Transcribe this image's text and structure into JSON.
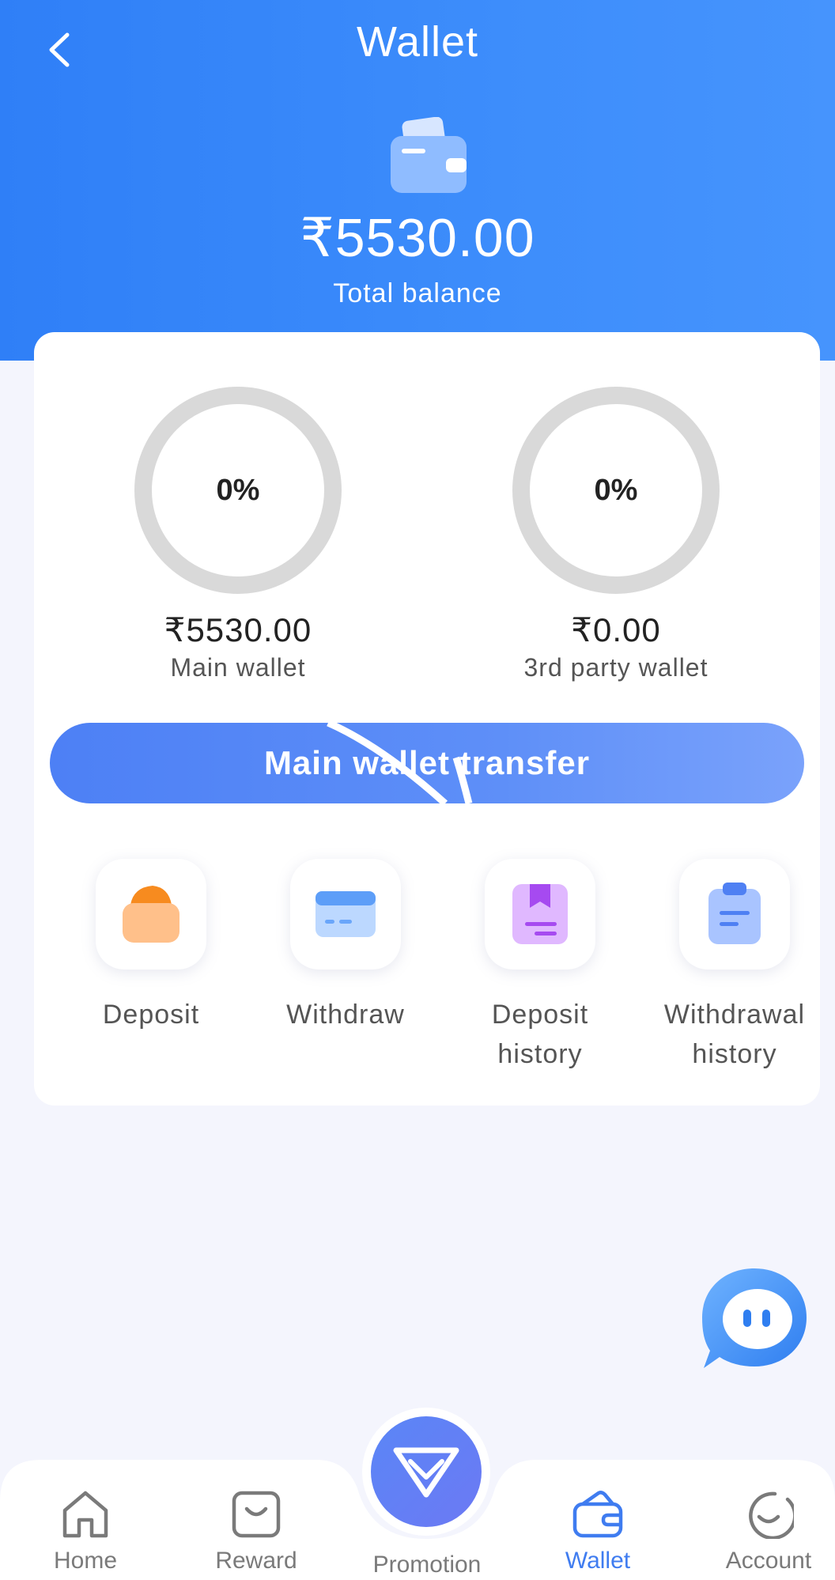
{
  "header": {
    "title": "Wallet",
    "total_amount": "₹5530.00",
    "total_label": "Total balance"
  },
  "wallets": {
    "main": {
      "percent": "0%",
      "amount": "₹5530.00",
      "label": "Main wallet"
    },
    "third_party": {
      "percent": "0%",
      "amount": "₹0.00",
      "label": "3rd party wallet"
    }
  },
  "transfer_button": {
    "label": "Main wallet transfer"
  },
  "actions": {
    "deposit": {
      "line1": "Deposit",
      "line2": ""
    },
    "withdraw": {
      "line1": "Withdraw",
      "line2": ""
    },
    "deposit_history": {
      "line1": "Deposit",
      "line2": "history"
    },
    "withdrawal_history": {
      "line1": "Withdrawal",
      "line2": "history"
    }
  },
  "tabbar": {
    "home": "Home",
    "reward": "Reward",
    "promotion": "Promotion",
    "wallet": "Wallet",
    "account": "Account",
    "active": "Wallet"
  },
  "colors": {
    "header_blue": "#3d8dfb",
    "accent_blue": "#3f7cf0",
    "gauge_track": "#d9d9d9"
  },
  "icons": [
    "chevron-left-icon",
    "wallet-icon",
    "deposit-icon",
    "withdraw-icon",
    "deposit-history-icon",
    "withdrawal-history-icon",
    "chat-icon",
    "home-icon",
    "reward-icon",
    "diamond-icon",
    "wallet-tab-icon",
    "account-icon"
  ]
}
